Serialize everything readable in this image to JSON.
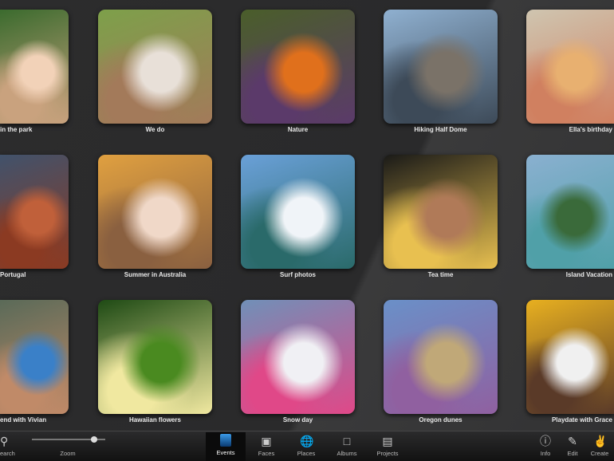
{
  "events": [
    {
      "title": "Day in the park",
      "visible_label": "in the park",
      "colors": [
        "#3b6b2e",
        "#f2d2b8",
        "#c9a27e"
      ]
    },
    {
      "title": "We do",
      "colors": [
        "#7da04a",
        "#e8e0d8",
        "#a37a5a"
      ]
    },
    {
      "title": "Nature",
      "colors": [
        "#4a5e2a",
        "#e0701c",
        "#5b3a6a"
      ]
    },
    {
      "title": "Hiking Half Dome",
      "colors": [
        "#8fb0d0",
        "#7a7268",
        "#3d4a58"
      ]
    },
    {
      "title": "Ella's birthday",
      "colors": [
        "#cfc5b0",
        "#e8b070",
        "#d08060"
      ]
    },
    {
      "title": "Portugal",
      "colors": [
        "#41526b",
        "#c0603a",
        "#8b3a22"
      ]
    },
    {
      "title": "Summer in Australia",
      "colors": [
        "#e0a040",
        "#f0d8c8",
        "#8a6040"
      ]
    },
    {
      "title": "Surf photos",
      "colors": [
        "#6aa0d8",
        "#f0f4f8",
        "#2a6a6a"
      ]
    },
    {
      "title": "Tea time",
      "colors": [
        "#1a1a18",
        "#b07a58",
        "#e8c050"
      ]
    },
    {
      "title": "Island Vacation",
      "colors": [
        "#8ab0d0",
        "#3a6a3a",
        "#50a0a8"
      ]
    },
    {
      "title": "Weekend with Vivian",
      "visible_label": "end with Vivian",
      "colors": [
        "#5a6a58",
        "#3a80c8",
        "#c08a68"
      ]
    },
    {
      "title": "Hawaiian flowers",
      "colors": [
        "#1e4a14",
        "#4a8a20",
        "#f0e8a0"
      ]
    },
    {
      "title": "Snow day",
      "colors": [
        "#7090b8",
        "#f0f0f4",
        "#e04888"
      ]
    },
    {
      "title": "Oregon dunes",
      "colors": [
        "#6a90c8",
        "#c0a878",
        "#9060a0"
      ]
    },
    {
      "title": "Playdate with Grace",
      "visible_label": "Playdate with Grace",
      "colors": [
        "#e8b020",
        "#f0f0f0",
        "#5a3a28"
      ]
    }
  ],
  "toolbar": {
    "search": "Search",
    "search_visible": "earch",
    "zoom": "Zoom",
    "zoom_level": 0.85,
    "tabs": [
      {
        "label": "Events",
        "icon": "events-icon",
        "active": true
      },
      {
        "label": "Faces",
        "icon": "faces-icon"
      },
      {
        "label": "Places",
        "icon": "globe-icon"
      },
      {
        "label": "Albums",
        "icon": "album-icon"
      },
      {
        "label": "Projects",
        "icon": "book-icon"
      }
    ],
    "right": [
      {
        "label": "Info",
        "icon": "info-icon"
      },
      {
        "label": "Edit",
        "icon": "pencil-icon"
      },
      {
        "label": "Create",
        "icon": "create-icon"
      }
    ]
  }
}
